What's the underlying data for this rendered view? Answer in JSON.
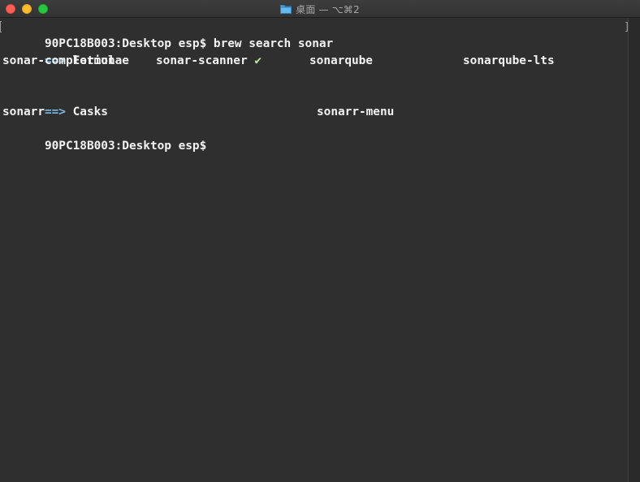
{
  "window": {
    "title": "桌面 — ⌥⌘2",
    "icon": "folder-icon"
  },
  "terminal": {
    "prompt_line": "90PC18B003:Desktop esp$ brew search sonar",
    "formulae_header": {
      "arrow": "==>",
      "label": " Formulae"
    },
    "formulae": [
      "sonar-completion",
      "sonar-scanner",
      "sonarqube",
      "sonarqube-lts"
    ],
    "installed_mark": "✔",
    "casks_header": {
      "arrow": "==>",
      "label": " Casks"
    },
    "casks": [
      "sonarr",
      "sonarr-menu"
    ],
    "final_prompt": "90PC18B003:Desktop esp$"
  },
  "colors": {
    "background": "#2f2f2f",
    "text": "#f2f2f2",
    "arrow": "#7ab9e0",
    "check": "#b6ea9b",
    "close": "#fd5f57",
    "minimize": "#febb2e",
    "zoom": "#27c840"
  }
}
